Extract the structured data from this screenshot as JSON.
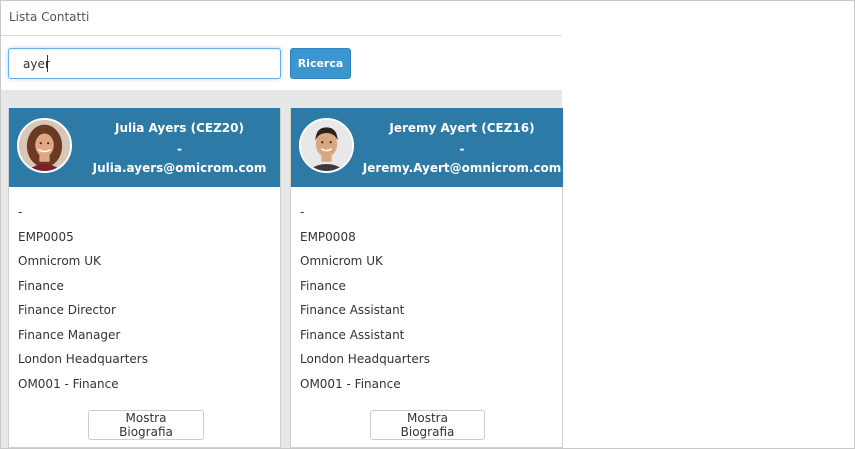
{
  "page": {
    "title": "Lista Contatti"
  },
  "search": {
    "value": "ayer",
    "button_label": "Ricerca"
  },
  "contacts": [
    {
      "name": "Julia Ayers (CEZ20)",
      "dash": "-",
      "email": "Julia.ayers@omicrom.com",
      "details": [
        "-",
        "EMP0005",
        "Omnicrom UK",
        "Finance",
        "Finance Director",
        "Finance Manager",
        "London Headquarters",
        "OM001 - Finance"
      ],
      "bio_button": "Mostra Biografia"
    },
    {
      "name": "Jeremy Ayert (CEZ16)",
      "dash": "-",
      "email": "Jeremy.Ayert@omnicrom.com",
      "details": [
        "-",
        "EMP0008",
        "Omnicrom UK",
        "Finance",
        "Finance Assistant",
        "Finance Assistant",
        "London Headquarters",
        "OM001 - Finance"
      ],
      "bio_button": "Mostra Biografia"
    }
  ],
  "colors": {
    "header_blue": "#2d7aa7",
    "button_blue": "#3a96cf",
    "results_bg": "#e7e7e7"
  }
}
